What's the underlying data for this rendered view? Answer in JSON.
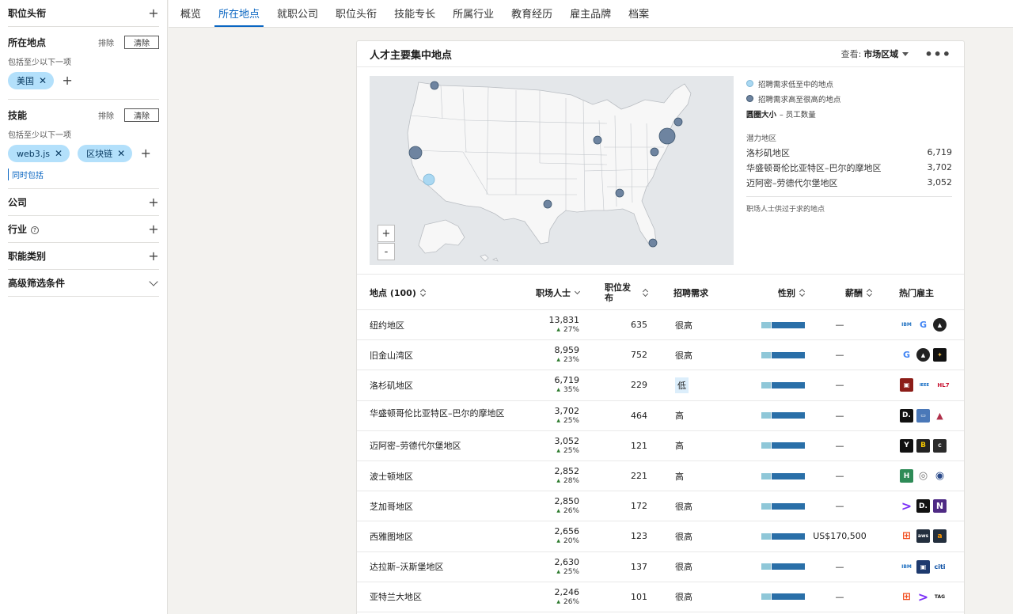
{
  "filters": {
    "job_title": {
      "label": "职位头衔"
    },
    "location": {
      "label": "所在地点",
      "exclude": "排除",
      "clear": "清除",
      "hint": "包括至少以下一项",
      "chips": [
        "美国"
      ]
    },
    "skills": {
      "label": "技能",
      "exclude": "排除",
      "clear": "清除",
      "hint": "包括至少以下一项",
      "chips": [
        "web3.js",
        "区块链"
      ],
      "also_include": "同时包括"
    },
    "company": {
      "label": "公司"
    },
    "industry": {
      "label": "行业"
    },
    "function": {
      "label": "职能类别"
    },
    "advanced": {
      "label": "高级筛选条件"
    }
  },
  "tabs": [
    "概览",
    "所在地点",
    "就职公司",
    "职位头衔",
    "技能专长",
    "所属行业",
    "教育经历",
    "雇主品牌",
    "档案"
  ],
  "active_tab": "所在地点",
  "card": {
    "title": "人才主要集中地点",
    "view_label": "查看:",
    "view_value": "市场区域"
  },
  "map": {
    "zoom_in": "+",
    "zoom_out": "-",
    "colors": {
      "land": "#f7f7f7",
      "border": "#b9bdc2",
      "water": "#e4e7ea",
      "high": "#6e84a0",
      "low": "#aad8f2"
    }
  },
  "legend": {
    "low_demand": "招聘需求低至中的地点",
    "high_demand": "招聘需求高至很高的地点",
    "size_label": "圆圈大小",
    "size_desc": "– 员工数量",
    "potential_title": "潜力地区",
    "potential": [
      {
        "name": "洛杉矶地区",
        "value": "6,719"
      },
      {
        "name": "华盛顿哥伦比亚特区–巴尔的摩地区",
        "value": "3,702"
      },
      {
        "name": "迈阿密–劳德代尔堡地区",
        "value": "3,052"
      }
    ],
    "footer": "职场人士供过于求的地点"
  },
  "table": {
    "headers": {
      "location": "地点 (100)",
      "professionals": "职场人士",
      "jobs": "职位发布",
      "demand": "招聘需求",
      "gender": "性别",
      "salary": "薪酬",
      "employers": "热门雇主"
    },
    "rows": [
      {
        "location": "纽约地区",
        "pros": "13,831",
        "growth": "27%",
        "jobs": "635",
        "demand": "很高",
        "salary": "—",
        "logos": [
          "IBM",
          "G",
          "▲"
        ]
      },
      {
        "location": "旧金山湾区",
        "pros": "8,959",
        "growth": "23%",
        "jobs": "752",
        "demand": "很高",
        "salary": "—",
        "logos": [
          "G",
          "▲",
          "✦"
        ]
      },
      {
        "location": "洛杉矶地区",
        "pros": "6,719",
        "growth": "35%",
        "jobs": "229",
        "demand": "低",
        "salary": "—",
        "logos": [
          "▣",
          "IEEE",
          "HL7"
        ]
      },
      {
        "location": "华盛顿哥伦比亚特区–巴尔的摩地区",
        "pros": "3,702",
        "growth": "25%",
        "jobs": "464",
        "demand": "高",
        "salary": "—",
        "logos": [
          "D.",
          "▭",
          "▲"
        ]
      },
      {
        "location": "迈阿密–劳德代尔堡地区",
        "pros": "3,052",
        "growth": "25%",
        "jobs": "121",
        "demand": "高",
        "salary": "—",
        "logos": [
          "Y",
          "B",
          "C"
        ]
      },
      {
        "location": "波士顿地区",
        "pros": "2,852",
        "growth": "28%",
        "jobs": "221",
        "demand": "高",
        "salary": "—",
        "logos": [
          "H",
          "◎",
          "◉"
        ]
      },
      {
        "location": "芝加哥地区",
        "pros": "2,850",
        "growth": "26%",
        "jobs": "172",
        "demand": "很高",
        "salary": "—",
        "logos": [
          ">",
          "D.",
          "N"
        ]
      },
      {
        "location": "西雅图地区",
        "pros": "2,656",
        "growth": "20%",
        "jobs": "123",
        "demand": "很高",
        "salary": "US$170,500",
        "logos": [
          "⊞",
          "aws",
          "a"
        ]
      },
      {
        "location": "达拉斯–沃斯堡地区",
        "pros": "2,630",
        "growth": "25%",
        "jobs": "137",
        "demand": "很高",
        "salary": "—",
        "logos": [
          "IBM",
          "▣",
          "citi"
        ]
      },
      {
        "location": "亚特兰大地区",
        "pros": "2,246",
        "growth": "26%",
        "jobs": "101",
        "demand": "很高",
        "salary": "—",
        "logos": [
          "⊞",
          ">",
          "TAG"
        ]
      }
    ]
  }
}
